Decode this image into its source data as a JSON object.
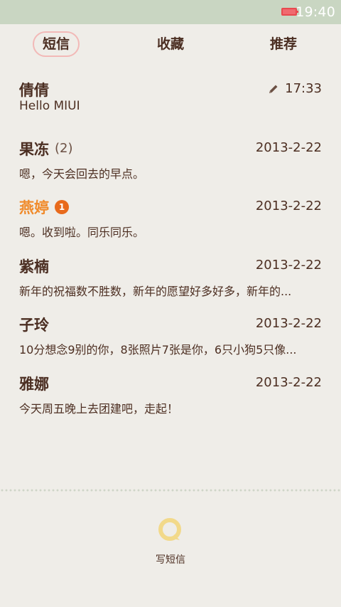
{
  "status": {
    "time": "19:40",
    "battery_color": "#e8494f"
  },
  "tabs": [
    {
      "label": "短信",
      "active": true
    },
    {
      "label": "收藏",
      "active": false
    },
    {
      "label": "推荐",
      "active": false
    }
  ],
  "conversations": [
    {
      "name": "倩倩",
      "date": "17:33",
      "preview": "Hello MIUI",
      "draft_icon": "pencil-icon"
    },
    {
      "name": "果冻",
      "count": "(2)",
      "date": "2013-2-22",
      "preview": "嗯，今天会回去的早点。"
    },
    {
      "name": "燕婷",
      "badge": "1",
      "date": "2013-2-22",
      "preview": "嗯。收到啦。同乐同乐。",
      "unread": true
    },
    {
      "name": "紫楠",
      "date": "2013-2-22",
      "preview": "新年的祝福数不胜数，新年的愿望好多好多，新年的..."
    },
    {
      "name": "子玲",
      "date": "2013-2-22",
      "preview": "10分想念9别的你，8张照片7张是你，6只小狗5只像..."
    },
    {
      "name": "雅娜",
      "date": "2013-2-22",
      "preview": "今天周五晚上去团建吧，走起！"
    }
  ],
  "compose": {
    "label": "写短信",
    "icon": "compose-message-icon",
    "icon_color": "#f2d98a"
  },
  "colors": {
    "status_bar": "#c9d6c2",
    "background": "#efede8",
    "text": "#4b2e22",
    "unread_name": "#f08a2a",
    "badge": "#e86a1c",
    "active_tab_ring": "#f2b9b7"
  }
}
